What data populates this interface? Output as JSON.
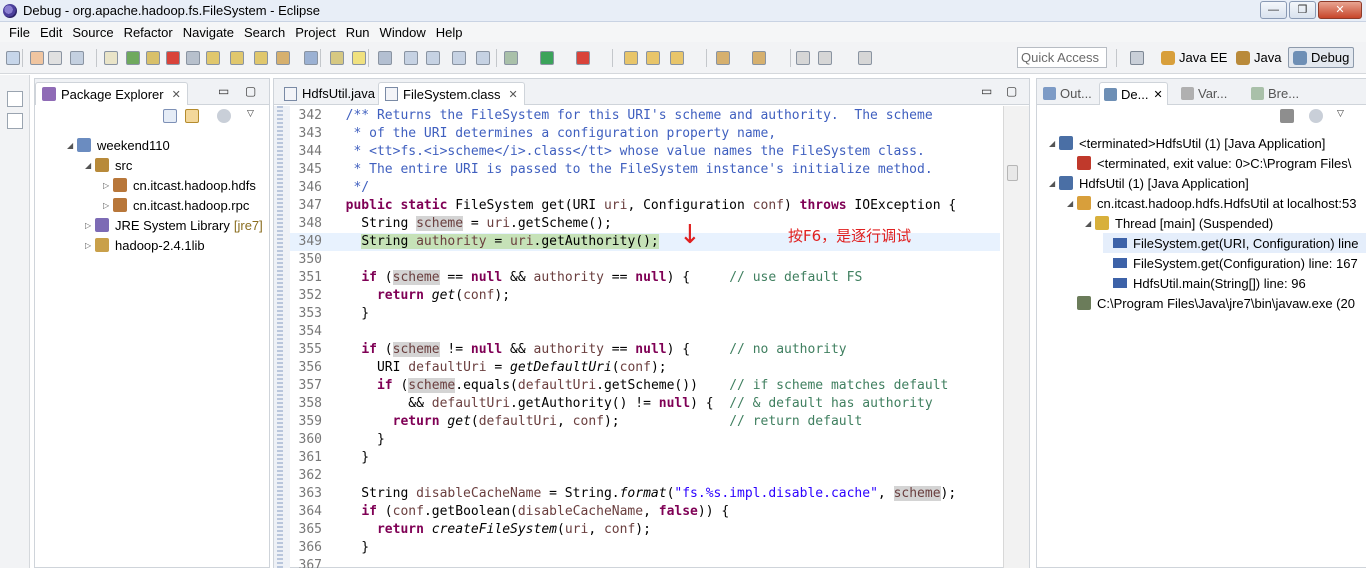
{
  "window": {
    "title": "Debug - org.apache.hadoop.fs.FileSystem - Eclipse",
    "min_label": "—",
    "max_label": "❐",
    "close_label": "✕"
  },
  "menu": [
    "File",
    "Edit",
    "Source",
    "Refactor",
    "Navigate",
    "Search",
    "Project",
    "Run",
    "Window",
    "Help"
  ],
  "toolbar": {
    "quick_access_placeholder": "Quick Access",
    "perspectives": [
      {
        "label": "Java EE",
        "active": false
      },
      {
        "label": "Java",
        "active": false
      },
      {
        "label": "Debug",
        "active": true
      }
    ]
  },
  "package_explorer": {
    "tab_label": "Package Explorer",
    "close_label": "✕",
    "min_label": "▭",
    "max_label": "▢",
    "tree": [
      {
        "label": "weekend110",
        "arrow": "◢",
        "depth": 0,
        "deco": ""
      },
      {
        "label": "src",
        "arrow": "◢",
        "depth": 1,
        "deco": ""
      },
      {
        "label": "cn.itcast.hadoop.hdfs",
        "arrow": "▷",
        "depth": 2,
        "deco": ""
      },
      {
        "label": "cn.itcast.hadoop.rpc",
        "arrow": "▷",
        "depth": 2,
        "deco": ""
      },
      {
        "label": "JRE System Library",
        "arrow": "▷",
        "depth": 1,
        "deco": "[jre7]"
      },
      {
        "label": "hadoop-2.4.1lib",
        "arrow": "▷",
        "depth": 1,
        "deco": ""
      }
    ]
  },
  "editor": {
    "tabs": [
      {
        "label": "HdfsUtil.java",
        "active": false
      },
      {
        "label": "FileSystem.class",
        "active": true
      }
    ],
    "close_label": "✕",
    "min_label": "▭",
    "max_label": "▢",
    "annotation_arrow": "↓",
    "annotation_text": "按F6，是逐行调试",
    "lines": [
      {
        "n": "342",
        "html": "  <span class=\"cm\">/** Returns the FileSystem for this URI's scheme and authority.  The scheme</span>"
      },
      {
        "n": "343",
        "html": "   <span class=\"cm\">* of the URI determines a configuration property name,</span>"
      },
      {
        "n": "344",
        "html": "   <span class=\"cm\">* &lt;tt&gt;fs.&lt;i&gt;scheme&lt;/i&gt;.class&lt;/tt&gt; whose value names the FileSystem class.</span>"
      },
      {
        "n": "345",
        "html": "   <span class=\"cm\">* The entire URI is passed to the FileSystem instance's initialize method.</span>"
      },
      {
        "n": "346",
        "html": "   <span class=\"cm\">*/</span>"
      },
      {
        "n": "347",
        "html": "  <span class=\"kw\">public static</span> FileSystem get(URI <span class=\"fld\">uri</span>, Configuration <span class=\"fld\">conf</span>) <span class=\"kw\">throws</span> IOException {"
      },
      {
        "n": "348",
        "html": "    String <span class=\"fld occ\">scheme</span> = <span class=\"fld\">uri</span>.getScheme();"
      },
      {
        "n": "349",
        "html": "    <span class=\"step-hl\">String <span class=\"fld\">authority</span> = <span class=\"fld\">uri</span>.getAuthority();</span>",
        "current": true
      },
      {
        "n": "350",
        "html": ""
      },
      {
        "n": "351",
        "html": "    <span class=\"kw\">if</span> (<span class=\"fld occ\">scheme</span> == <span class=\"kw\">null</span> &amp;&amp; <span class=\"fld\">authority</span> == <span class=\"kw\">null</span>) {     <span class=\"lc\">// use default FS</span>"
      },
      {
        "n": "352",
        "html": "      <span class=\"kw\">return</span> <span class=\"it\">get</span>(<span class=\"fld\">conf</span>);"
      },
      {
        "n": "353",
        "html": "    }"
      },
      {
        "n": "354",
        "html": ""
      },
      {
        "n": "355",
        "html": "    <span class=\"kw\">if</span> (<span class=\"fld occ\">scheme</span> != <span class=\"kw\">null</span> &amp;&amp; <span class=\"fld\">authority</span> == <span class=\"kw\">null</span>) {     <span class=\"lc\">// no authority</span>"
      },
      {
        "n": "356",
        "html": "      URI <span class=\"fld\">defaultUri</span> = <span class=\"it\">getDefaultUri</span>(<span class=\"fld\">conf</span>);"
      },
      {
        "n": "357",
        "html": "      <span class=\"kw\">if</span> (<span class=\"fld occ\">scheme</span>.equals(<span class=\"fld\">defaultUri</span>.getScheme())    <span class=\"lc\">// if scheme matches default</span>"
      },
      {
        "n": "358",
        "html": "          &amp;&amp; <span class=\"fld\">defaultUri</span>.getAuthority() != <span class=\"kw\">null</span>) {  <span class=\"lc\">// &amp; default has authority</span>"
      },
      {
        "n": "359",
        "html": "        <span class=\"kw\">return</span> <span class=\"it\">get</span>(<span class=\"fld\">defaultUri</span>, <span class=\"fld\">conf</span>);              <span class=\"lc\">// return default</span>"
      },
      {
        "n": "360",
        "html": "      }"
      },
      {
        "n": "361",
        "html": "    }"
      },
      {
        "n": "362",
        "html": ""
      },
      {
        "n": "363",
        "html": "    String <span class=\"fld\">disableCacheName</span> = String.<span class=\"it\">format</span>(<span class=\"st\">\"fs.%s.impl.disable.cache\"</span>, <span class=\"fld occ\">scheme</span>);"
      },
      {
        "n": "364",
        "html": "    <span class=\"kw\">if</span> (<span class=\"fld\">conf</span>.getBoolean(<span class=\"fld\">disableCacheName</span>, <span class=\"kw\">false</span>)) {"
      },
      {
        "n": "365",
        "html": "      <span class=\"kw\">return</span> <span class=\"it\">createFileSystem</span>(<span class=\"fld\">uri</span>, <span class=\"fld\">conf</span>);"
      },
      {
        "n": "366",
        "html": "    }"
      },
      {
        "n": "367",
        "html": ""
      }
    ]
  },
  "debug_view": {
    "tabs": [
      {
        "label": "Out...",
        "active": false
      },
      {
        "label": "De...",
        "active": true
      },
      {
        "label": "Var...",
        "active": false
      },
      {
        "label": "Bre...",
        "active": false
      }
    ],
    "close_label": "✕",
    "tree": [
      {
        "label": "<terminated>HdfsUtil (1) [Java Application]",
        "arrow": "◢",
        "depth": 0
      },
      {
        "label": "<terminated, exit value: 0>C:\\Program Files\\",
        "arrow": "",
        "depth": 1
      },
      {
        "label": "HdfsUtil (1) [Java Application]",
        "arrow": "◢",
        "depth": 0
      },
      {
        "label": "cn.itcast.hadoop.hdfs.HdfsUtil at localhost:53",
        "arrow": "◢",
        "depth": 1
      },
      {
        "label": "Thread [main] (Suspended)",
        "arrow": "◢",
        "depth": 2
      },
      {
        "label": "FileSystem.get(URI, Configuration) line",
        "arrow": "",
        "depth": 3,
        "selected": true
      },
      {
        "label": "FileSystem.get(Configuration) line: 167",
        "arrow": "",
        "depth": 3
      },
      {
        "label": "HdfsUtil.main(String[]) line: 96",
        "arrow": "",
        "depth": 3
      },
      {
        "label": "C:\\Program Files\\Java\\jre7\\bin\\javaw.exe (20",
        "arrow": "",
        "depth": 1
      }
    ]
  }
}
